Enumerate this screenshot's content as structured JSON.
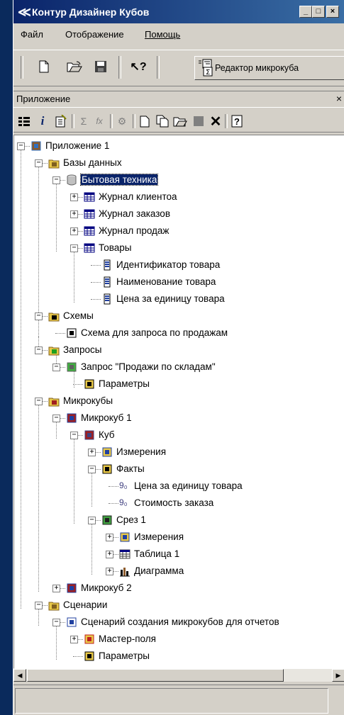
{
  "window": {
    "title": "Контур Дизайнер Кубов",
    "controls": [
      "_",
      "□",
      "×"
    ],
    "app_icon": "kontur-logo-icon"
  },
  "menu": [
    "Файл",
    "Отображение",
    "Помощь"
  ],
  "toolbar": {
    "buttons": [
      "new-file-icon",
      "open-folder-icon",
      "save-icon",
      "help-pointer-icon"
    ],
    "cube_editor_label": "Редактор микрокуба",
    "cube_editor_icon": "microcube-editor-icon"
  },
  "panel": {
    "title": "Приложение",
    "close": "×",
    "tools": [
      "list-view-icon",
      "info-icon",
      "properties-icon",
      "sum-icon",
      "function-icon",
      "settings-icon",
      "new-icon",
      "copy-icon",
      "open-icon",
      "stop-icon",
      "delete-icon",
      "help-icon"
    ]
  },
  "tree": [
    {
      "label": "Приложение 1",
      "icon": "application-icon"
    },
    {
      "label": "Базы данных",
      "icon": "databases-folder-icon"
    },
    {
      "label": "Бытовая техника",
      "icon": "database-icon",
      "selected": true
    },
    {
      "label": "Журнал клиентоа",
      "icon": "table-icon"
    },
    {
      "label": "Журнал заказов",
      "icon": "table-icon"
    },
    {
      "label": "Журнал продаж",
      "icon": "table-icon"
    },
    {
      "label": "Товары",
      "icon": "table-icon"
    },
    {
      "label": "Идентификатор товара",
      "icon": "field-icon"
    },
    {
      "label": "Наименование товара",
      "icon": "field-icon"
    },
    {
      "label": "Цена за единицу товара",
      "icon": "field-icon"
    },
    {
      "label": "Схемы",
      "icon": "schemas-folder-icon"
    },
    {
      "label": "Схема для запроса по продажам",
      "icon": "schema-icon"
    },
    {
      "label": "Запросы",
      "icon": "queries-folder-icon"
    },
    {
      "label": "Запрос \"Продажи по складам\"",
      "icon": "query-icon"
    },
    {
      "label": "Параметры",
      "icon": "parameters-icon"
    },
    {
      "label": "Микрокубы",
      "icon": "microcubes-folder-icon"
    },
    {
      "label": "Микрокуб 1",
      "icon": "microcube-icon"
    },
    {
      "label": "Куб",
      "icon": "cube-icon"
    },
    {
      "label": "Измерения",
      "icon": "dimensions-icon"
    },
    {
      "label": "Факты",
      "icon": "facts-icon"
    },
    {
      "label": "Цена за единицу товара",
      "icon": "fact-measure-icon"
    },
    {
      "label": "Стоимость заказа",
      "icon": "fact-measure-icon"
    },
    {
      "label": "Срез 1",
      "icon": "slice-icon"
    },
    {
      "label": "Измерения",
      "icon": "dimensions-icon"
    },
    {
      "label": "Таблица 1",
      "icon": "grid-table-icon"
    },
    {
      "label": "Диаграмма",
      "icon": "chart-icon"
    },
    {
      "label": "Микрокуб 2",
      "icon": "microcube-icon"
    },
    {
      "label": "Сценарии",
      "icon": "scenarios-folder-icon"
    },
    {
      "label": "Сценарий создания микрокубов для отчетов",
      "icon": "scenario-icon"
    },
    {
      "label": "Мастер-поля",
      "icon": "master-fields-icon"
    },
    {
      "label": "Параметры",
      "icon": "parameters-icon"
    }
  ],
  "fact_glyph": "9₀",
  "expanders": {
    "plus": "+",
    "minus": "−"
  },
  "scroll": {
    "left": "◀",
    "right": "▶"
  },
  "colors": {
    "titlebar": "#0a246a",
    "selection": "#0a246a",
    "desktop": "#0a2a5c"
  }
}
